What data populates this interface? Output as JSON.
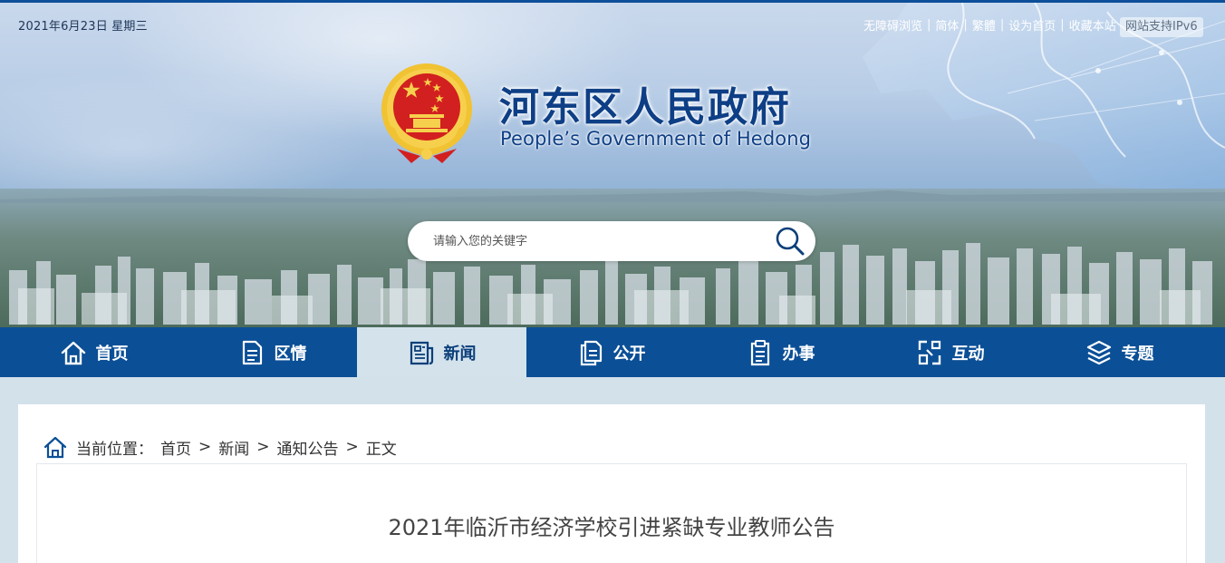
{
  "colors": {
    "brand_blue": "#0b4f96",
    "title_blue": "#0e3f86",
    "nav_active_bg": "#d4e2ec",
    "page_bg": "#d3e1ea"
  },
  "topbar": {
    "date": "2021年6月23日   星期三",
    "links": [
      "无障碍浏览",
      "简体",
      "繁體",
      "设为首页",
      "收藏本站"
    ],
    "ipv6_badge": "网站支持IPv6"
  },
  "header": {
    "emblem_icon": "national-emblem-icon",
    "title": "河东区人民政府",
    "subtitle": "People’s Government of Hedong"
  },
  "search": {
    "placeholder": "请输入您的关键字",
    "value": "",
    "icon": "search-icon"
  },
  "nav": {
    "items": [
      {
        "label": "首页",
        "icon": "home-icon",
        "active": false
      },
      {
        "label": "区情",
        "icon": "document-icon",
        "active": false
      },
      {
        "label": "新闻",
        "icon": "news-icon",
        "active": true
      },
      {
        "label": "公开",
        "icon": "files-icon",
        "active": false
      },
      {
        "label": "办事",
        "icon": "clipboard-icon",
        "active": false
      },
      {
        "label": "互动",
        "icon": "interact-icon",
        "active": false
      },
      {
        "label": "专题",
        "icon": "layers-icon",
        "active": false
      }
    ]
  },
  "breadcrumb": {
    "label": "当前位置：",
    "items": [
      "首页",
      "新闻",
      "通知公告",
      "正文"
    ],
    "separator": ">"
  },
  "article": {
    "title": "2021年临沂市经济学校引进紧缺专业教师公告"
  }
}
